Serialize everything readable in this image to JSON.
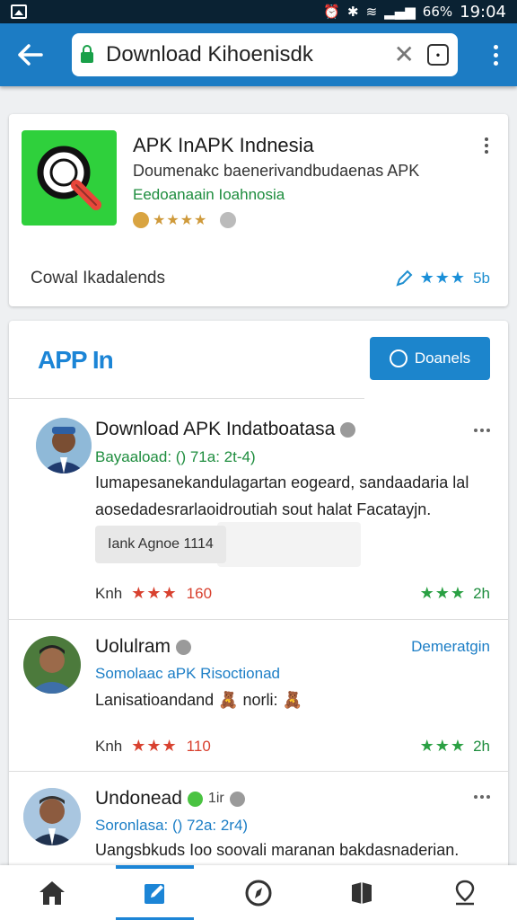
{
  "status_bar": {
    "battery": "66%",
    "time": "19:04"
  },
  "browser": {
    "url_text": "Download Kihoenisdk",
    "clear_icon": "close-icon",
    "tab_count_icon": "tab-count-icon"
  },
  "app_card": {
    "title": "APK InAPK Indnesia",
    "description": "Doumenakc baenerivandbudaenas APK",
    "developer": "Eedoanaain Ioahnosia",
    "rating_stars": "★★★★",
    "downloads_label": "Cowal Ikadalends",
    "footer_stars": "★★★",
    "footer_count": "5b"
  },
  "panel": {
    "title": "APP In",
    "button_label": "Doanels",
    "colors": {
      "accent": "#1c85d6",
      "green": "#1e8d3e",
      "red": "#d8412f"
    }
  },
  "items": [
    {
      "name": "Download APK Indatboatasa",
      "sub": "Bayaaload: () 71a: 2t-4)",
      "body_line1": "Iumapesanekandulagartan eogeard, sandaadaria lal",
      "body_line2": "aosedadesrarlaoidroutiah sout halat Facatayjn.",
      "chip": "Iank Agnoe 1114",
      "meta_label": "Knh",
      "meta_stars": "★★★",
      "meta_count": "160",
      "right_stars": "★★★",
      "right_count": "2h"
    },
    {
      "name": "Uolulram",
      "sub": "Somolaac aPK Risoctionad",
      "body_line1": "Lanisatioandand 🧸 norli: 🧸",
      "link": "Demeratgin",
      "meta_label": "Knh",
      "meta_stars": "★★★",
      "meta_count": "110",
      "right_stars": "★★★",
      "right_count": "2h"
    },
    {
      "name": "Undonead",
      "name_suffix": "1ir",
      "sub": "Soronlasa: () 72a: 2r4)",
      "body_line1": "Uangsbkuds Ioo soovali maranan bakdasnaderian."
    }
  ],
  "bottom_nav": [
    "home-icon",
    "edit-icon",
    "compass-icon",
    "book-icon",
    "location-icon"
  ]
}
